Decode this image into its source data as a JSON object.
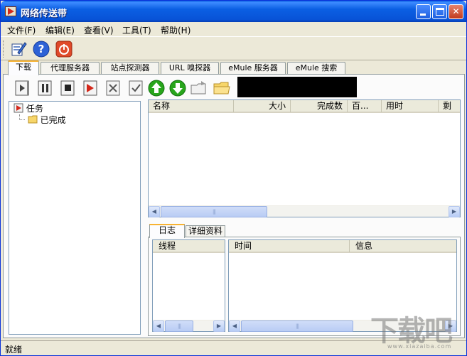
{
  "window": {
    "title": "网络传送带"
  },
  "menu": {
    "items": [
      "文件(F)",
      "编辑(E)",
      "查看(V)",
      "工具(T)",
      "帮助(H)"
    ]
  },
  "main_toolbar": {
    "icons": [
      "edit-icon",
      "help-icon",
      "power-icon"
    ]
  },
  "tabs": [
    {
      "label": "下载",
      "active": true
    },
    {
      "label": "代理服务器"
    },
    {
      "label": "站点探测器"
    },
    {
      "label": "URL 嗅探器"
    },
    {
      "label": "eMule 服务器"
    },
    {
      "label": "eMule 搜索"
    }
  ],
  "download_toolbar": {
    "icons": [
      "start-icon",
      "pause-icon",
      "stop-icon",
      "new-task-icon",
      "delete-icon",
      "check-icon",
      "move-up-icon",
      "move-down-icon",
      "open-folder-icon",
      "folder-icon"
    ]
  },
  "tree": {
    "root": "任务",
    "child": "已完成"
  },
  "task_list": {
    "columns": [
      "名称",
      "大小",
      "完成数",
      "百...",
      "用时",
      "剩"
    ]
  },
  "lower_tabs": [
    {
      "label": "日志",
      "active": true
    },
    {
      "label": "详细资料"
    }
  ],
  "thread_list": {
    "columns": [
      "线程"
    ]
  },
  "log_list": {
    "columns": [
      "时间",
      "信息"
    ]
  },
  "status": {
    "text": "就绪"
  },
  "watermark": {
    "text": "下载吧",
    "sub": "www.xiazaiba.com"
  },
  "colors": {
    "titlebar": "#0b5fe3",
    "tab_highlight": "#f8b332",
    "up_arrow": "#27a51b",
    "down_arrow": "#27a51b"
  }
}
